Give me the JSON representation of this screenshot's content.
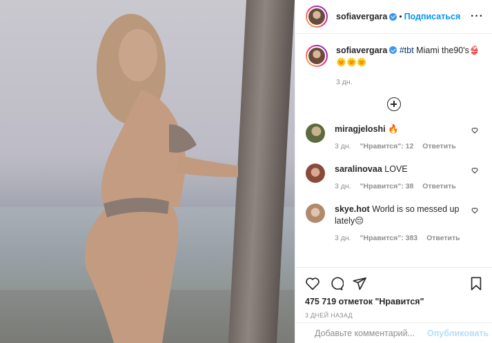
{
  "header": {
    "username": "sofiavergara",
    "separator": "•",
    "follow_label": "Подписаться",
    "more_label": "···"
  },
  "caption": {
    "username": "sofiavergara",
    "hashtag": "#tbt",
    "text": " Miami the90's👙",
    "emojis": "🌞🌞🌞",
    "time": "3 дн."
  },
  "comments": [
    {
      "username": "miragjeloshi",
      "text": " 🔥",
      "time": "3 дн.",
      "likes": "\"Нравится\": 12",
      "reply": "Ответить"
    },
    {
      "username": "saralinovaa",
      "text": " LOVE",
      "time": "3 дн.",
      "likes": "\"Нравится\": 38",
      "reply": "Ответить"
    },
    {
      "username": "skye.hot",
      "text": " World is so messed up lately😔",
      "time": "3 дн.",
      "likes": "\"Нравится\": 383",
      "reply": "Ответить"
    }
  ],
  "actions": {
    "likes_count": "475 719 отметок \"Нравится\"",
    "date": "3 ДНЕЙ НАЗАД"
  },
  "add_comment": {
    "placeholder": "Добавьте комментарий...",
    "publish_label": "Опубликовать"
  },
  "colors": {
    "accent": "#0095f6",
    "verified": "#3897f0",
    "muted": "#8e8e8e",
    "publish_disabled": "#b2dffc"
  },
  "icons": [
    "verified-badge-icon",
    "more-options-icon",
    "load-more-icon",
    "heart-icon",
    "comment-icon",
    "share-icon",
    "save-icon",
    "emoji-icon"
  ]
}
